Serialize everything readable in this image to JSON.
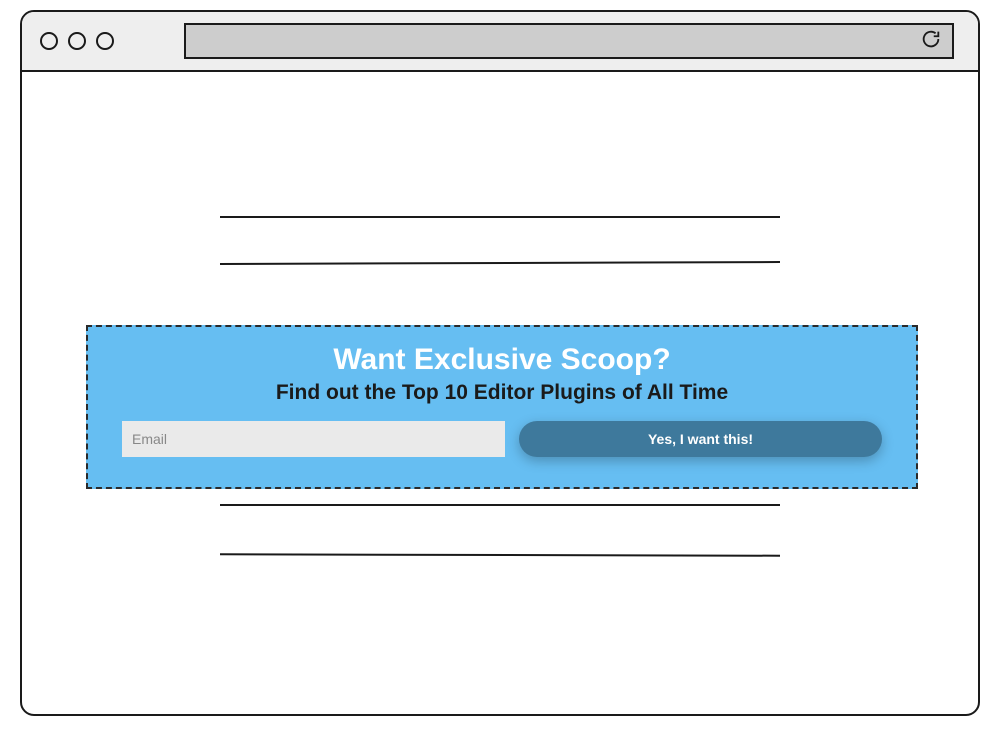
{
  "banner": {
    "title": "Want Exclusive Scoop?",
    "subtitle": "Find out the Top 10 Editor Plugins of All Time",
    "email_placeholder": "Email",
    "cta_label": "Yes, I want this!"
  }
}
